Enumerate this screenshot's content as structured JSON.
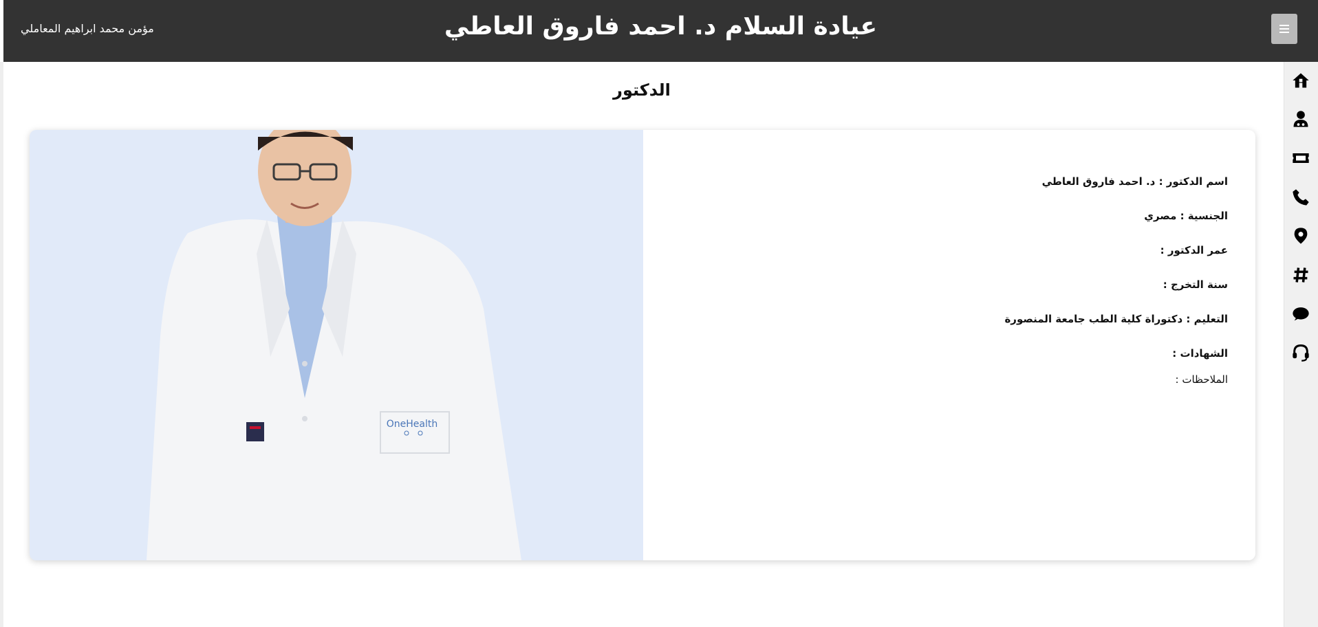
{
  "header": {
    "title": "عيادة السلام د. احمد فاروق العاطي",
    "user_name": "مؤمن محمد ابراهيم المعاملي"
  },
  "page": {
    "heading": "الدكتور"
  },
  "doctor": {
    "name": "اسم الدكتور : د. احمد فاروق العاطي",
    "nationality": "الجنسية : مصري",
    "age": "عمر الدكتور :",
    "graduation_year": "سنة التخرج :",
    "education": "التعليم : دكتوراة كلية الطب جامعة المنصورة",
    "certificates": "الشهادات :",
    "notes": "الملاحظات :"
  },
  "photo": {
    "coat_logo_text": "OneHealth"
  },
  "sidebar": {
    "icons": [
      "home-icon",
      "doctor-icon",
      "ticket-icon",
      "phone-icon",
      "location-icon",
      "hashtag-icon",
      "chat-icon",
      "support-icon"
    ]
  },
  "colors": {
    "topbar_bg": "#333333",
    "menu_button_bg": "#b9b9b9",
    "photo_bg": "#e1eaf9",
    "sidebar_bg": "#f0f0f0"
  }
}
